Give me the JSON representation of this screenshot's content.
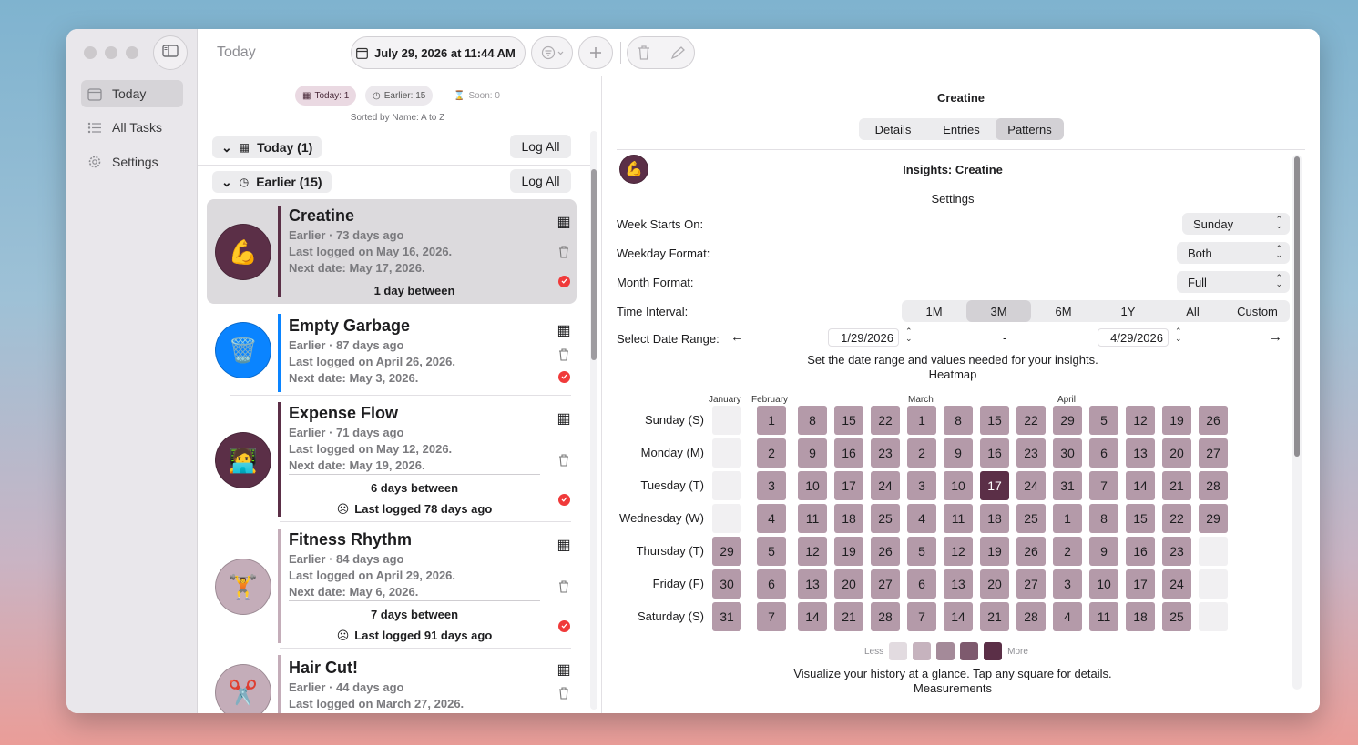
{
  "sidebar": {
    "items": [
      {
        "label": "Today",
        "icon": "calendar-icon",
        "active": true
      },
      {
        "label": "All Tasks",
        "icon": "list-icon",
        "active": false
      },
      {
        "label": "Settings",
        "icon": "gear-icon",
        "active": false
      }
    ]
  },
  "toolbar": {
    "title": "Today",
    "date_label": "July 29, 2026 at 11:44 AM"
  },
  "list": {
    "chips": {
      "today": "Today: 1",
      "earlier": "Earlier: 15",
      "soon": "Soon: 0"
    },
    "sorted_label": "Sorted by Name: A to Z",
    "groups": [
      {
        "label": "Today (1)",
        "button": "Log All"
      },
      {
        "label": "Earlier (15)",
        "button": "Log All"
      }
    ],
    "tasks": [
      {
        "name": "Creatine",
        "line1": "Earlier · 73 days ago",
        "line2": "Last logged on May 16, 2026.",
        "line3": "Next date: May 17, 2026.",
        "between": "1 day between",
        "extra": "",
        "emoji": "💪",
        "color": "#5b2f47"
      },
      {
        "name": "Empty Garbage",
        "line1": "Earlier · 87 days ago",
        "line2": "Last logged on April 26, 2026.",
        "line3": "Next date: May 3, 2026.",
        "between": "",
        "extra": "",
        "emoji": "🗑️",
        "color": "#0a84ff"
      },
      {
        "name": "Expense Flow",
        "line1": "Earlier · 71 days ago",
        "line2": "Last logged on May 12, 2026.",
        "line3": "Next date: May 19, 2026.",
        "between": "6 days between",
        "extra": "Last logged 78 days ago",
        "emoji": "🧑‍💻",
        "color": "#5b2f47"
      },
      {
        "name": "Fitness Rhythm",
        "line1": "Earlier · 84 days ago",
        "line2": "Last logged on April 29, 2026.",
        "line3": "Next date: May 6, 2026.",
        "between": "7 days between",
        "extra": "Last logged 91 days ago",
        "emoji": "🏋️",
        "color": "#c4adb9"
      },
      {
        "name": "Hair Cut!",
        "line1": "Earlier · 44 days ago",
        "line2": "Last logged on March 27, 2026.",
        "line3": "",
        "between": "",
        "extra": "",
        "emoji": "✂️",
        "color": "#c4adb9"
      }
    ]
  },
  "detail": {
    "title": "Creatine",
    "tabs": [
      "Details",
      "Entries",
      "Patterns"
    ],
    "active_tab": "Patterns",
    "insights_title": "Insights: Creatine",
    "settings_header": "Settings",
    "week_starts_label": "Week Starts On:",
    "week_starts_value": "Sunday",
    "weekday_format_label": "Weekday Format:",
    "weekday_format_value": "Both",
    "month_format_label": "Month Format:",
    "month_format_value": "Full",
    "time_interval_label": "Time Interval:",
    "intervals": [
      "1M",
      "3M",
      "6M",
      "1Y",
      "All",
      "Custom"
    ],
    "active_interval": "3M",
    "date_range_label": "Select Date Range:",
    "start_date": "1/29/2026",
    "end_date": "4/29/2026",
    "range_sep": "-",
    "range_hint": "Set the date range and values needed for your insights.",
    "heatmap_title": "Heatmap",
    "months": [
      "January",
      "February",
      "March",
      "April"
    ],
    "weekdays": [
      "Sunday (S)",
      "Monday (M)",
      "Tuesday (T)",
      "Wednesday (W)",
      "Thursday (T)",
      "Friday (F)",
      "Saturday (S)"
    ],
    "weeks": [
      [
        "",
        "",
        "",
        "",
        "29",
        "30",
        "31"
      ],
      [
        "1",
        "2",
        "3",
        "4",
        "5",
        "6",
        "7"
      ],
      [
        "8",
        "9",
        "10",
        "11",
        "12",
        "13",
        "14"
      ],
      [
        "15",
        "16",
        "17",
        "18",
        "19",
        "20",
        "21"
      ],
      [
        "22",
        "23",
        "24",
        "25",
        "26",
        "27",
        "28"
      ],
      [
        "1",
        "2",
        "3",
        "4",
        "5",
        "6",
        "7"
      ],
      [
        "8",
        "9",
        "10",
        "11",
        "12",
        "13",
        "14"
      ],
      [
        "15",
        "16",
        "17",
        "18",
        "19",
        "20",
        "21"
      ],
      [
        "22",
        "23",
        "24",
        "25",
        "26",
        "27",
        "28"
      ],
      [
        "29",
        "30",
        "31",
        "1",
        "2",
        "3",
        "4"
      ],
      [
        "5",
        "6",
        "7",
        "8",
        "9",
        "10",
        "11"
      ],
      [
        "12",
        "13",
        "14",
        "15",
        "16",
        "17",
        "18"
      ],
      [
        "19",
        "20",
        "21",
        "22",
        "23",
        "24",
        "25"
      ],
      [
        "26",
        "27",
        "28",
        "29",
        "",
        "",
        ""
      ]
    ],
    "highlight_cell": {
      "week": 7,
      "day": 2
    },
    "legend_less": "Less",
    "legend_more": "More",
    "legend_colors": [
      "#e2dbe0",
      "#c6b3be",
      "#a48a99",
      "#7e5a6e",
      "#5b2f47"
    ],
    "footer_text": "Visualize your history at a glance. Tap any square for details.",
    "measurements_label": "Measurements"
  },
  "colors": {
    "accent": "#5b2f47",
    "cell": "#b49aa9",
    "blue": "#0a84ff",
    "red": "#f03a3a"
  }
}
